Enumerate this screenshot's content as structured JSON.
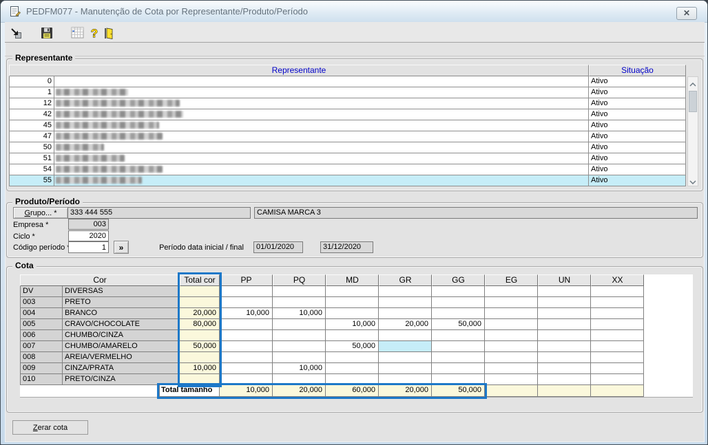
{
  "window": {
    "title": "PEDFM077 - Manutenção de Cota por Representante/Produto/Período"
  },
  "toolbar": {
    "icons": [
      "confirm",
      "save",
      "grid",
      "help",
      "exit"
    ]
  },
  "representante": {
    "group_label": "Representante",
    "col_representante": "Representante",
    "col_situacao": "Situação",
    "rows": [
      {
        "code": "0",
        "redacted_width": 0,
        "situacao": "Ativo",
        "selected": false
      },
      {
        "code": "1",
        "redacted_width": 105,
        "situacao": "Ativo",
        "selected": false
      },
      {
        "code": "12",
        "redacted_width": 180,
        "situacao": "Ativo",
        "selected": false
      },
      {
        "code": "42",
        "redacted_width": 185,
        "situacao": "Ativo",
        "selected": false
      },
      {
        "code": "45",
        "redacted_width": 150,
        "situacao": "Ativo",
        "selected": false
      },
      {
        "code": "47",
        "redacted_width": 155,
        "situacao": "Ativo",
        "selected": false
      },
      {
        "code": "50",
        "redacted_width": 70,
        "situacao": "Ativo",
        "selected": false
      },
      {
        "code": "51",
        "redacted_width": 100,
        "situacao": "Ativo",
        "selected": false
      },
      {
        "code": "54",
        "redacted_width": 155,
        "situacao": "Ativo",
        "selected": false
      },
      {
        "code": "55",
        "redacted_width": 125,
        "situacao": "Ativo",
        "selected": true
      }
    ]
  },
  "produto_periodo": {
    "group_label": "Produto/Período",
    "grupo_button": "Grupo... *",
    "grupo_code": "333 444 555",
    "grupo_desc": "CAMISA MARCA 3",
    "empresa_label": "Empresa *",
    "empresa_value": "003",
    "ciclo_label": "Ciclo *",
    "ciclo_value": "2020",
    "codigo_label": "Código período *",
    "codigo_value": "1",
    "expand_button": "»",
    "periodo_label": "Período data inicial / final",
    "data_inicial": "01/01/2020",
    "data_final": "31/12/2020"
  },
  "cota": {
    "group_label": "Cota",
    "header_cor": "Cor",
    "header_total": "Total cor",
    "size_columns": [
      "PP",
      "PQ",
      "MD",
      "GR",
      "GG",
      "EG",
      "UN",
      "XX"
    ],
    "rows": [
      {
        "code": "DV",
        "name": "DIVERSAS",
        "total": "",
        "sizes": [
          "",
          "",
          "",
          "",
          "",
          "",
          "",
          ""
        ]
      },
      {
        "code": "003",
        "name": "PRETO",
        "total": "",
        "sizes": [
          "",
          "",
          "",
          "",
          "",
          "",
          "",
          ""
        ]
      },
      {
        "code": "004",
        "name": "BRANCO",
        "total": "20,000",
        "sizes": [
          "10,000",
          "10,000",
          "",
          "",
          "",
          "",
          "",
          ""
        ]
      },
      {
        "code": "005",
        "name": "CRAVO/CHOCOLATE",
        "total": "80,000",
        "sizes": [
          "",
          "",
          "10,000",
          "20,000",
          "50,000",
          "",
          "",
          ""
        ]
      },
      {
        "code": "006",
        "name": "CHUMBO/CINZA",
        "total": "",
        "sizes": [
          "",
          "",
          "",
          "",
          "",
          "",
          "",
          ""
        ]
      },
      {
        "code": "007",
        "name": "CHUMBO/AMARELO",
        "total": "50,000",
        "sizes": [
          "",
          "",
          "50,000",
          "",
          "",
          "",
          "",
          ""
        ],
        "selected_size": "GR"
      },
      {
        "code": "008",
        "name": "AREIA/VERMELHO",
        "total": "",
        "sizes": [
          "",
          "",
          "",
          "",
          "",
          "",
          "",
          ""
        ]
      },
      {
        "code": "009",
        "name": "CINZA/PRATA",
        "total": "10,000",
        "sizes": [
          "",
          "10,000",
          "",
          "",
          "",
          "",
          "",
          ""
        ]
      },
      {
        "code": "010",
        "name": "PRETO/CINZA",
        "total": "",
        "sizes": [
          "",
          "",
          "",
          "",
          "",
          "",
          "",
          ""
        ]
      }
    ],
    "total_row": {
      "label": "Total tamanho",
      "values": [
        "10,000",
        "20,000",
        "60,000",
        "20,000",
        "50,000",
        "",
        "",
        ""
      ]
    }
  },
  "footer": {
    "zerar_button": "Zerar cota"
  },
  "colors": {
    "accent_outline": "#1d78c8",
    "selection": "#c6edf8",
    "cell_yellow": "#fbf8dc",
    "header_text_blue": "#0000c8"
  }
}
